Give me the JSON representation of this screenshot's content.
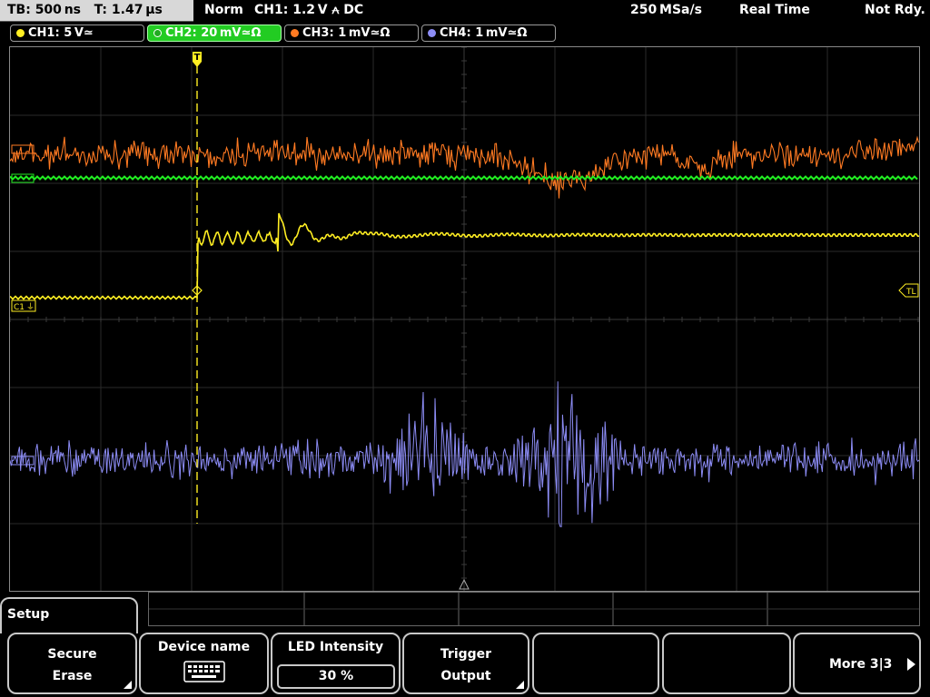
{
  "status": {
    "timebase": "TB: 500 ns",
    "trigger_time": "T: 1.47 µs",
    "trigger_mode": "Norm",
    "trigger_source": "CH1: 1.2 V ⩜ DC",
    "sample_rate": "250 MSa/s",
    "acq_mode": "Real Time",
    "state": "Not Rdy."
  },
  "channels": [
    {
      "label": "CH1: 5 V≃",
      "color": "#ffee22",
      "active": false
    },
    {
      "label": "CH2: 20 mV≃Ω",
      "color": "#22ee22",
      "active": true
    },
    {
      "label": "CH3: 1 mV≃Ω",
      "color": "#ff7a22",
      "active": false
    },
    {
      "label": "CH4: 1 mV≃Ω",
      "color": "#8c8cf5",
      "active": false
    }
  ],
  "markers": {
    "ch1": "C1",
    "trigger_level": "TL",
    "trigger_pos": "T"
  },
  "menu": {
    "title": "Setup",
    "keys": {
      "secure_erase": [
        "Secure",
        "Erase"
      ],
      "device_name": "Device name",
      "led_intensity": "LED Intensity",
      "led_value": "30 %",
      "trigger_output": [
        "Trigger",
        "Output"
      ],
      "more": "More 3|3"
    }
  },
  "icons": {
    "keyboard": "keyboard-icon",
    "more": "arrow-right-icon"
  }
}
